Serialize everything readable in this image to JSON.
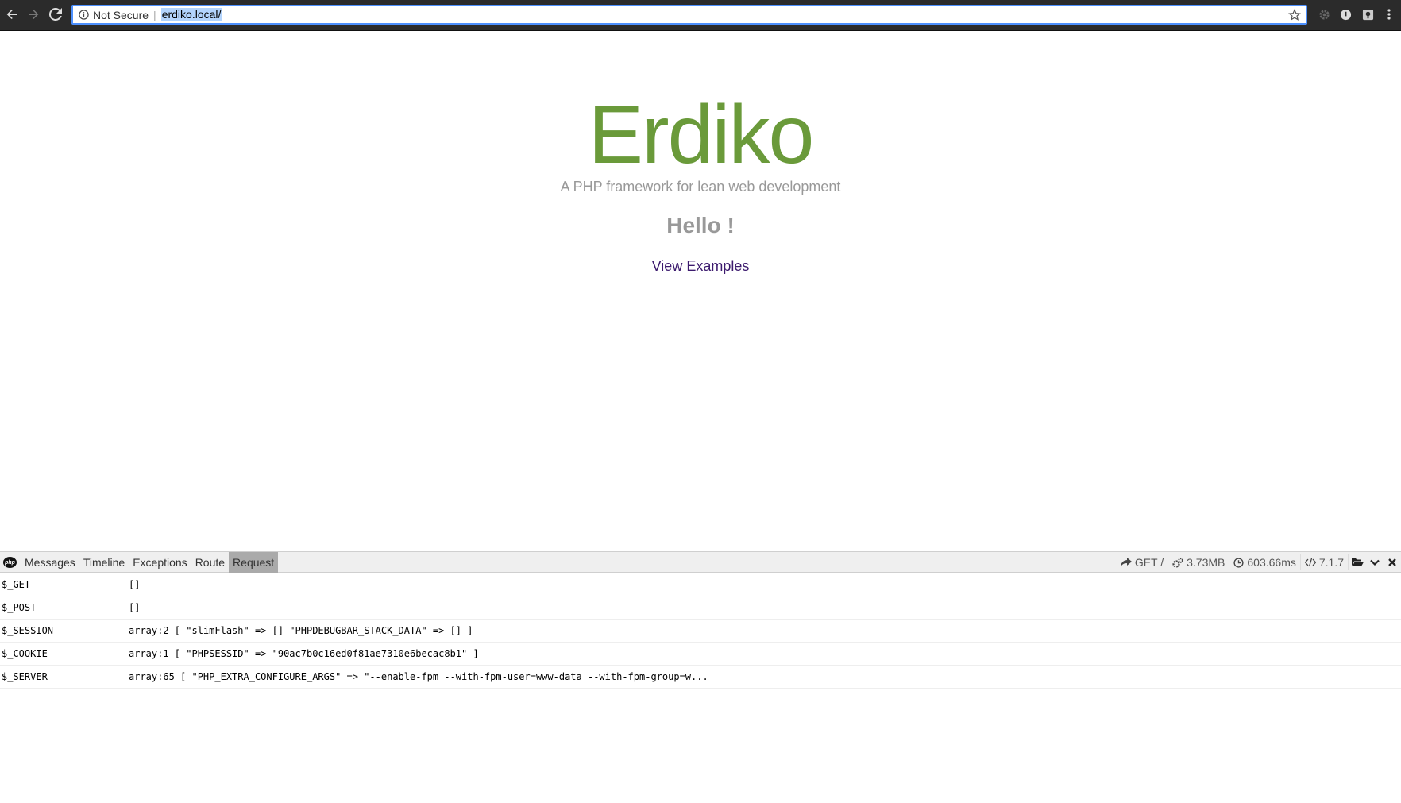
{
  "browser": {
    "security_label": "Not Secure",
    "separator": "|",
    "url": "erdiko.local/"
  },
  "page": {
    "title": "Erdiko",
    "tagline": "A PHP framework for lean web development",
    "greeting": "Hello !",
    "link_label": "View Examples"
  },
  "debugbar": {
    "tabs": [
      "Messages",
      "Timeline",
      "Exceptions",
      "Route",
      "Request"
    ],
    "active_tab": "Request",
    "method_route": "GET /",
    "memory": "3.73MB",
    "duration": "603.66ms",
    "php_version": "7.1.7",
    "rows": [
      {
        "key": "$_GET",
        "value": "[]"
      },
      {
        "key": "$_POST",
        "value": "[]"
      },
      {
        "key": "$_SESSION",
        "value": "array:2 [ \"slimFlash\" => [] \"PHPDEBUGBAR_STACK_DATA\" => [] ]"
      },
      {
        "key": "$_COOKIE",
        "value": "array:1 [ \"PHPSESSID\" => \"90ac7b0c16ed0f81ae7310e6becac8b1\" ]"
      },
      {
        "key": "$_SERVER",
        "value": "array:65 [ \"PHP_EXTRA_CONFIGURE_ARGS\" => \"--enable-fpm --with-fpm-user=www-data --with-fpm-group=w..."
      }
    ]
  },
  "colors": {
    "brand_green": "#6a9a3a",
    "muted_text": "#999999",
    "link": "#3c1a6e"
  }
}
